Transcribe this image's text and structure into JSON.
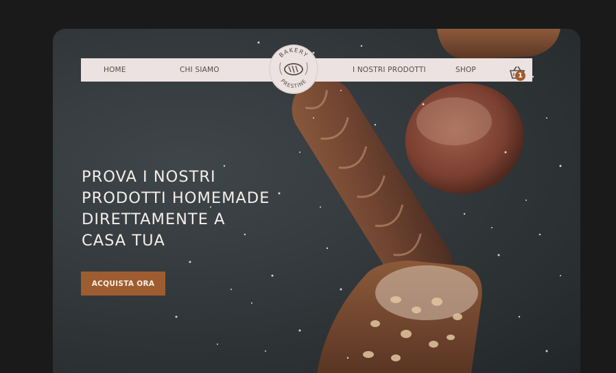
{
  "nav": {
    "items": [
      {
        "label": "HOME"
      },
      {
        "label": "CHI SIAMO"
      },
      {
        "label": "I NOSTRI PRODOTTI"
      },
      {
        "label": "SHOP"
      }
    ],
    "cart_count": "1"
  },
  "logo": {
    "top_text": "BAKERY",
    "bottom_text": "PRESTINE"
  },
  "hero": {
    "headline_lines": [
      "PROVA I NOSTRI",
      "PRODOTTI HOMEMADE",
      "DIRETTAMENTE A",
      "CASA TUA"
    ],
    "cta_label": "ACQUISTA ORA"
  },
  "colors": {
    "nav_bg": "#ece2e1",
    "accent": "#9e5d31",
    "hero_bg": "#343a3d",
    "text_light": "#f4eeea"
  }
}
